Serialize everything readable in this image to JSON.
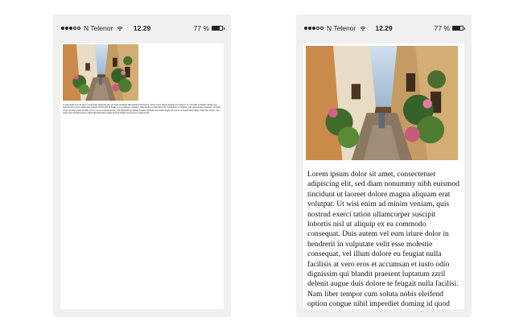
{
  "phones": [
    {
      "status": {
        "carrier": "N Telenor",
        "time": "12.29",
        "battery": "77 %",
        "battery_level": 0.77,
        "signal_bars": 3
      },
      "photo_icon": "street-alley-photo"
    },
    {
      "status": {
        "carrier": "N Telenor",
        "time": "12.29",
        "battery": "77 %",
        "battery_level": 0.77,
        "signal_bars": 3
      },
      "photo_icon": "street-alley-photo"
    }
  ],
  "paragraph": "Lorem ipsum dolor sit amet, consectetuer adipiscing elit, sed diam nonummy nibh euismod tincidunt ut laoreet dolore magna aliquam erat volutpat. Ut wisi enim ad minim veniam, quis nostrud exerci tation ullamcorper suscipit lobortis nisl ut aliquip ex ea commodo consequat. Duis autem vel eum iriure dolor in hendrerit in vulputate velit esse molestie consequat, vel illum dolore eu feugiat nulla facilisis at vero eros et accumsan et iusto odio dignissim qui blandit praesent luptatum zzril delenit augue duis dolore te feugait nulla facilisi. Nam liber tempor cum soluta nobis eleifend option congue nihil imperdiet doming id quod mazim placerat facer possim assum."
}
